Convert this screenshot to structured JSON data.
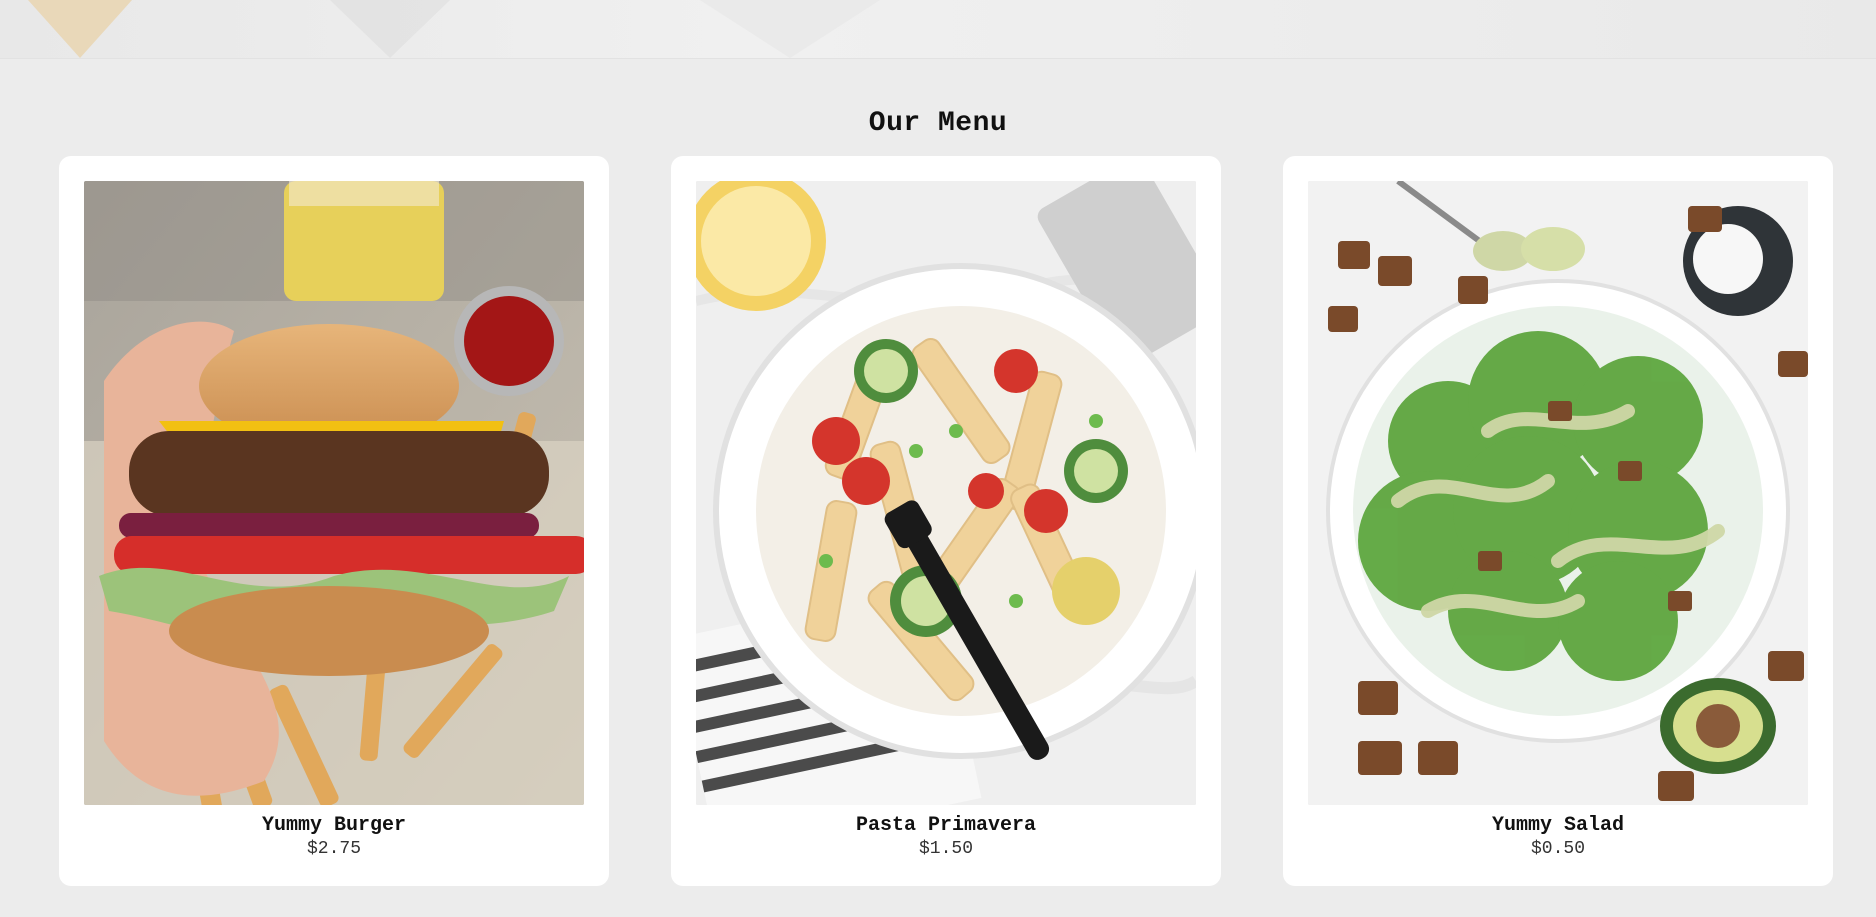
{
  "page": {
    "title": "Our Menu"
  },
  "menu": {
    "items": [
      {
        "name": "Yummy Burger",
        "price": "$2.75",
        "image": "burger-photo"
      },
      {
        "name": "Pasta Primavera",
        "price": "$1.50",
        "image": "pasta-photo"
      },
      {
        "name": "Yummy Salad",
        "price": "$0.50",
        "image": "salad-photo"
      }
    ]
  },
  "colors": {
    "page_background": "#ececec",
    "card_background": "#ffffff",
    "text": "#111111"
  }
}
